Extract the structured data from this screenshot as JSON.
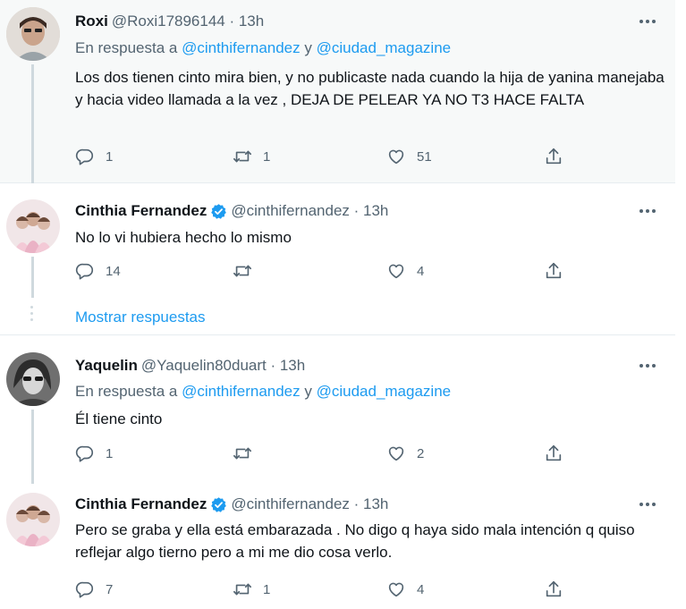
{
  "tweets": [
    {
      "name": "Roxi",
      "handle": "@Roxi17896144 · 13h",
      "verified": false,
      "reply_prefix": "En respuesta a ",
      "reply_user1": "@cinthifernandez",
      "reply_and": " y ",
      "reply_user2": "@ciudad_magazine",
      "text": "Los dos tienen cinto mira bien, y no publicaste nada cuando la hija de yanina manejaba y hacia video llamada a la vez , DEJA DE PELEAR YA NO T3 HACE FALTA",
      "replies": "1",
      "retweets": "1",
      "likes": "51"
    },
    {
      "name": "Cinthia Fernandez",
      "handle": "@cinthifernandez · 13h",
      "verified": true,
      "text": "No lo vi hubiera hecho lo mismo",
      "replies": "14",
      "retweets": "",
      "likes": "4",
      "show_replies": "Mostrar respuestas"
    },
    {
      "name": "Yaquelin",
      "handle": "@Yaquelin80duart · 13h",
      "verified": false,
      "reply_prefix": "En respuesta a ",
      "reply_user1": "@cinthifernandez",
      "reply_and": " y ",
      "reply_user2": "@ciudad_magazine",
      "text": "Él tiene cinto",
      "replies": "1",
      "retweets": "",
      "likes": "2"
    },
    {
      "name": "Cinthia Fernandez",
      "handle": "@cinthifernandez · 13h",
      "verified": true,
      "text": "Pero se graba y ella está embarazada . No digo q haya sido mala intención q quiso reflejar algo tierno pero a mi me dio cosa verlo.",
      "replies": "7",
      "retweets": "1",
      "likes": "4"
    }
  ],
  "colors": {
    "accent": "#1d9bf0",
    "secondary_text": "#536471",
    "highlight_bg": "#f7f9f9"
  },
  "icons": [
    "reply-icon",
    "retweet-icon",
    "like-icon",
    "share-icon",
    "verified-icon",
    "more-icon"
  ]
}
